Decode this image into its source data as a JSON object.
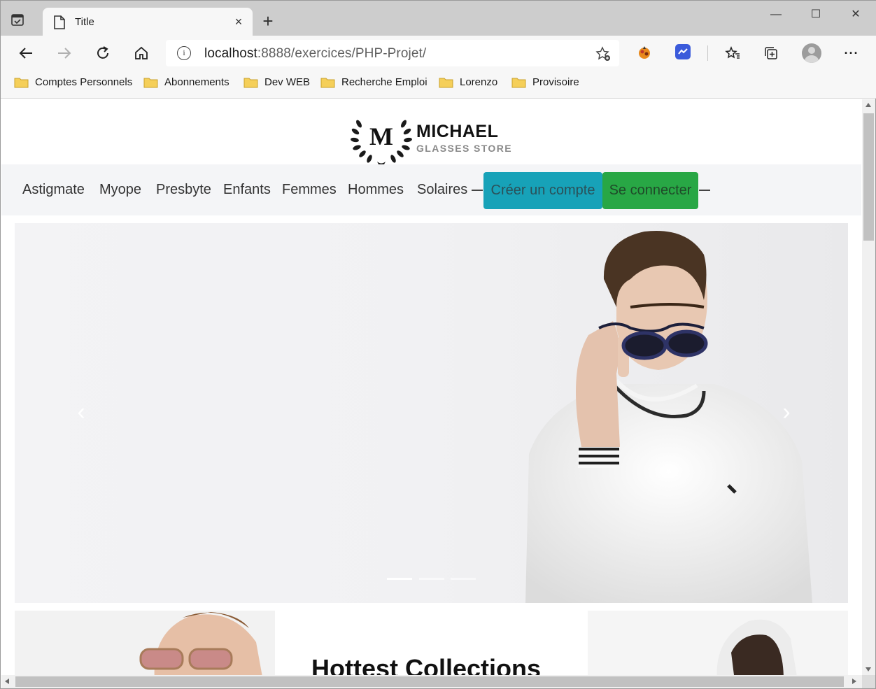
{
  "browser": {
    "tab_title": "Title",
    "tab_close": "×",
    "new_tab": "+",
    "window": {
      "minimize": "—",
      "maximize": "☐",
      "close": "✕"
    },
    "address": {
      "host": "localhost",
      "rest": ":8888/exercices/PHP-Projet/",
      "info": "i"
    },
    "bookmarks": [
      "Comptes Personnels",
      "Abonnements",
      "Dev WEB",
      "Recherche Emploi",
      "Lorenzo",
      "Provisoire"
    ],
    "more": "···"
  },
  "site": {
    "logo": {
      "monogram": "M",
      "name": "MICHAEL",
      "sub": "GLASSES STORE"
    },
    "nav": [
      "Astigmate",
      "Myope",
      "Presbyte",
      "Enfants",
      "Femmes",
      "Hommes",
      "Solaires"
    ],
    "buttons": {
      "create": "Créer un compte",
      "login": "Se connecter"
    },
    "carousel": {
      "prev": "‹",
      "next": "›",
      "slides": 3,
      "active": 0
    },
    "section_title": "Hottest Collections"
  },
  "colors": {
    "create_button": "#17a2b8",
    "login_button": "#28a745",
    "navbar_bg": "#f4f5f7",
    "chrome_bg": "#f7f7f7",
    "tabstrip_bg": "#cdcdcd"
  }
}
